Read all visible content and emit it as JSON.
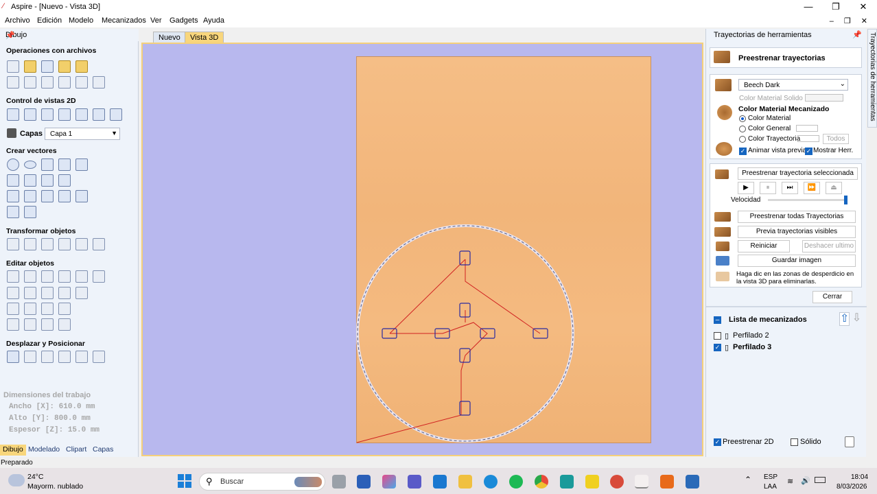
{
  "window": {
    "title": "Aspire - [Nuevo - Vista 3D]",
    "min": "—",
    "max": "❐",
    "close": "✕"
  },
  "menu": [
    "Archivo",
    "Edición",
    "Modelo",
    "Mecanizados",
    "Ver",
    "Gadgets",
    "Ayuda"
  ],
  "mdi_controls": "– ❐ ✕",
  "left_panel": {
    "header": "Dibujo",
    "sections": {
      "file_ops": "Operaciones con archivos",
      "view2d": "Control de vistas 2D",
      "create_vectors": "Crear vectores",
      "transform": "Transformar objetos",
      "edit": "Editar objetos",
      "move": "Desplazar y Posicionar"
    },
    "layers_label": "Capas",
    "layer_value": "Capa 1",
    "job_dims": {
      "title": "Dimensiones del trabajo",
      "width": "Ancho   [X]: 610.0 mm",
      "height": "Alto   [Y]: 800.0 mm",
      "thickness": "Espesor [Z]: 15.0 mm"
    },
    "tabs": [
      "Dibujo",
      "Modelado",
      "Clipart",
      "Capas"
    ]
  },
  "doc_tabs": [
    "Nuevo",
    "Vista 3D"
  ],
  "right_panel": {
    "header": "Trayectorias de herramientas",
    "preview_title": "Preestrenar trayectorias",
    "material_value": "Beech Dark",
    "solid_color_label": "Color Material Solido",
    "machined_color_label": "Color Material Mecanizado",
    "radio_material": "Color Material",
    "radio_general": "Color General",
    "radio_toolpath": "Color Trayectoria",
    "todos": "Todos",
    "animate": "Animar vista previa",
    "show_tool": "Mostrar Herr.",
    "preview_selected": "Preestrenar trayectoria seleccionada",
    "speed_label": "Velocidad",
    "speed": 1.0,
    "preview_all": "Preestrenar todas Trayectorias",
    "preview_visible": "Previa trayectorias visibles",
    "reset": "Reiniciar",
    "undo_last": "Deshacer ultimo",
    "save_image": "Guardar imagen",
    "hint": "Haga dic en las zonas de desperdicio en la vista 3D para eliminarlas.",
    "close": "Cerrar",
    "toolpath_list_title": "Lista de mecanizados",
    "toolpaths": [
      {
        "name": "Perfilado 2",
        "checked": false
      },
      {
        "name": "Perfilado 3",
        "checked": true
      }
    ],
    "preview2d": "Preestrenar 2D",
    "solid": "Sólido"
  },
  "vertical_tab": "Trayectorias de herramientas",
  "status": "Preparado",
  "taskbar": {
    "weather_temp": "24°C",
    "weather_desc": "Mayorm. nublado",
    "search": "Buscar",
    "lang1": "ESP",
    "lang2": "LAA",
    "time": "18:04",
    "date": "8/03/2026"
  },
  "colors": {
    "accent": "#f8d67c",
    "board": "#f3b77c",
    "viewport": "#b8b8ee",
    "vector_blue": "#2a2aa0",
    "toolpath_red": "#d02020"
  }
}
